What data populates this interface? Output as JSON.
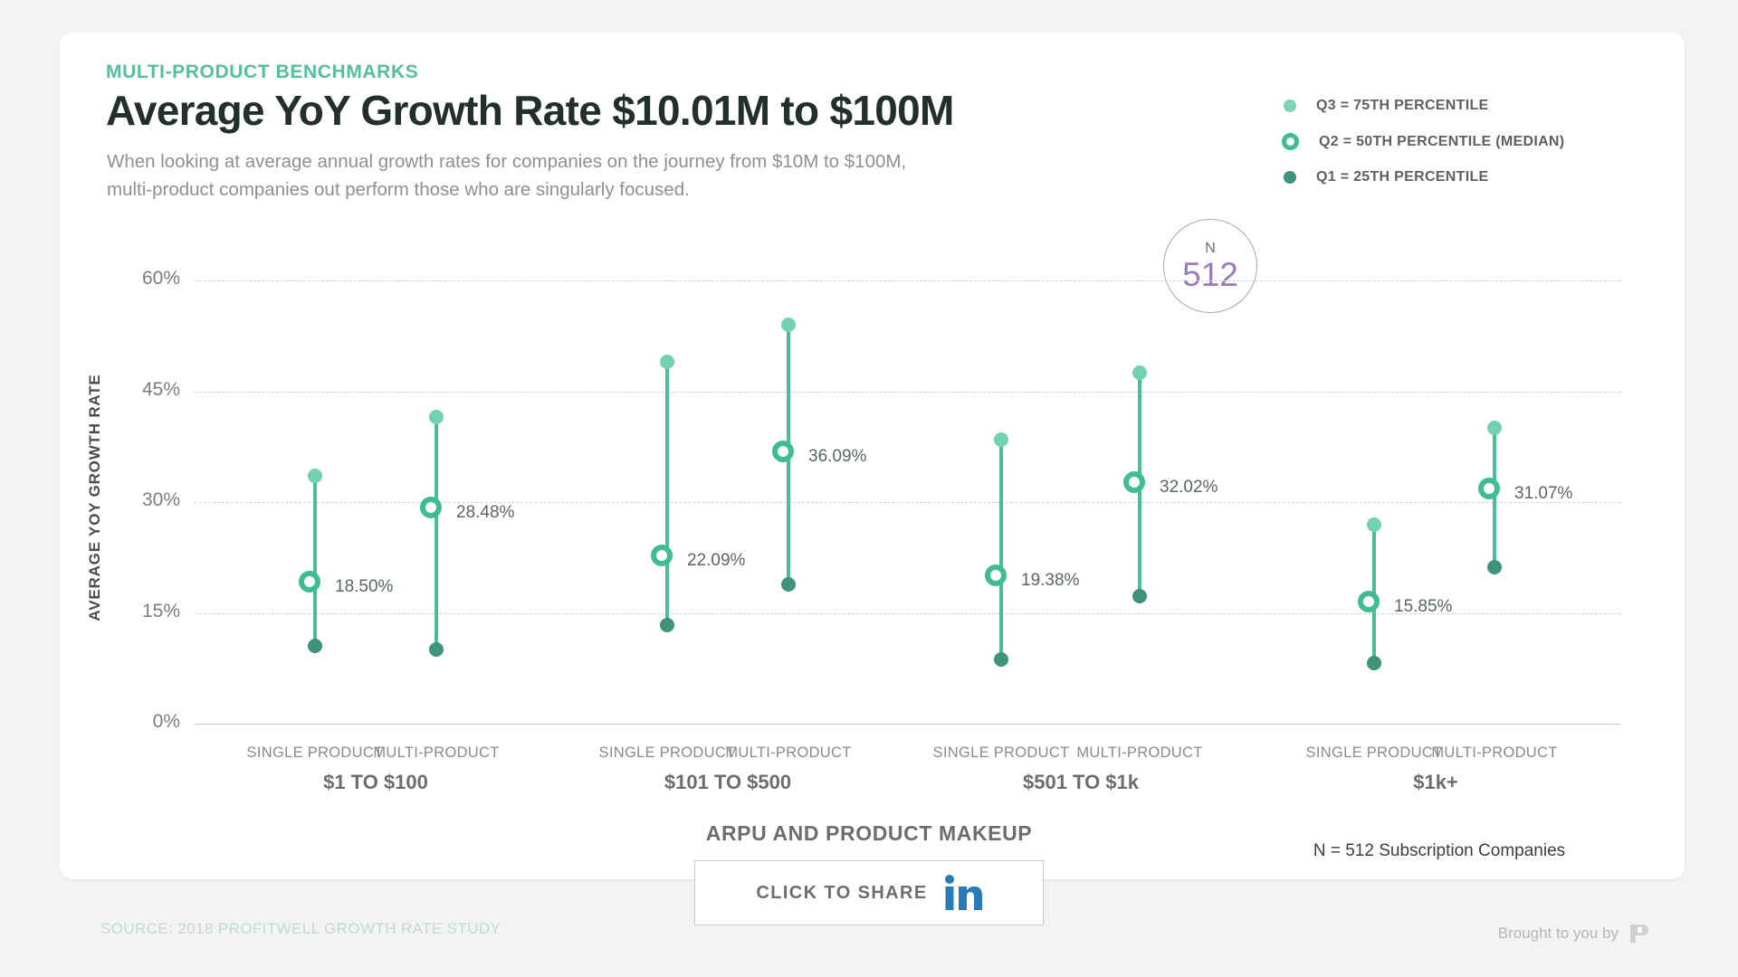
{
  "header": {
    "eyebrow": "MULTI-PRODUCT BENCHMARKS",
    "title": "Average YoY Growth Rate $10.01M to $100M",
    "subtitle_line1": "When looking at average annual growth rates for companies on the journey from $10M to $100M,",
    "subtitle_line2": "multi-product companies out perform those who are singularly focused."
  },
  "legend": {
    "items": [
      {
        "label": "Q3 = 75TH PERCENTILE",
        "marker": "q3-dot-icon",
        "color": "#7fd4b4"
      },
      {
        "label": "Q2 = 50TH PERCENTILE (MEDIAN)",
        "marker": "q2-ring-icon",
        "color": "#3fbd92"
      },
      {
        "label": "Q1 = 25TH PERCENTILE",
        "marker": "q1-dot-icon",
        "color": "#3e937a"
      }
    ]
  },
  "n_badge": {
    "label": "N",
    "value": "512"
  },
  "footer": {
    "n_note": "N = 512 Subscription Companies",
    "source": "SOURCE: 2018 PROFITWELL GROWTH RATE STUDY",
    "brought_to_you_by": "Brought to you by",
    "share_label": "CLICK TO SHARE",
    "share_icon": "linkedin-icon"
  },
  "chart_data": {
    "type": "scatter",
    "title": "Average YoY Growth Rate $10.01M to $100M",
    "xlabel": "ARPU AND PRODUCT MAKEUP",
    "ylabel": "AVERAGE YOY GROWTH RATE",
    "ylim": [
      0,
      60
    ],
    "yticks": [
      "0%",
      "15%",
      "30%",
      "45%",
      "60%"
    ],
    "ytick_values": [
      0,
      15,
      30,
      45,
      60
    ],
    "grid": true,
    "legend_position": "top-right",
    "groups": [
      "$1 TO $100",
      "$101 TO $500",
      "$501 TO $1k",
      "$1k+"
    ],
    "categories": [
      "SINGLE PRODUCT",
      "MULTI-PRODUCT"
    ],
    "series": [
      {
        "name": "Q3 = 75TH PERCENTILE",
        "values": [
          33.5,
          41.5,
          49.0,
          54.0,
          38.5,
          47.5,
          27.0,
          40.0
        ]
      },
      {
        "name": "Q2 = 50TH PERCENTILE (MEDIAN)",
        "values": [
          18.5,
          28.48,
          22.09,
          36.09,
          19.38,
          32.02,
          15.85,
          31.07
        ]
      },
      {
        "name": "Q1 = 25TH PERCENTILE",
        "values": [
          10.5,
          10.0,
          13.3,
          18.8,
          8.7,
          17.3,
          8.2,
          21.2
        ]
      }
    ],
    "points": [
      {
        "group": "$1 TO $100",
        "category": "SINGLE PRODUCT",
        "q1": 10.5,
        "q2": 18.5,
        "q3": 33.5,
        "median_label": "18.50%"
      },
      {
        "group": "$1 TO $100",
        "category": "MULTI-PRODUCT",
        "q1": 10.0,
        "q2": 28.48,
        "q3": 41.5,
        "median_label": "28.48%"
      },
      {
        "group": "$101 TO $500",
        "category": "SINGLE PRODUCT",
        "q1": 13.3,
        "q2": 22.09,
        "q3": 49.0,
        "median_label": "22.09%"
      },
      {
        "group": "$101 TO $500",
        "category": "MULTI-PRODUCT",
        "q1": 18.8,
        "q2": 36.09,
        "q3": 54.0,
        "median_label": "36.09%"
      },
      {
        "group": "$501 TO $1k",
        "category": "SINGLE PRODUCT",
        "q1": 8.7,
        "q2": 19.38,
        "q3": 38.5,
        "median_label": "19.38%"
      },
      {
        "group": "$501 TO $1k",
        "category": "MULTI-PRODUCT",
        "q1": 17.3,
        "q2": 32.02,
        "q3": 47.5,
        "median_label": "32.02%"
      },
      {
        "group": "$1k+",
        "category": "SINGLE PRODUCT",
        "q1": 8.2,
        "q2": 15.85,
        "q3": 27.0,
        "median_label": "15.85%"
      },
      {
        "group": "$1k+",
        "category": "MULTI-PRODUCT",
        "q1": 21.2,
        "q2": 31.07,
        "q3": 40.0,
        "median_label": "31.07%"
      }
    ]
  },
  "colors": {
    "accent": "#4cbd99",
    "q3": "#72d2b0",
    "q2": "#3fbd92",
    "q1": "#3e937a",
    "badge_number": "#9a7cb8",
    "linkedin": "#2a7ab9"
  }
}
